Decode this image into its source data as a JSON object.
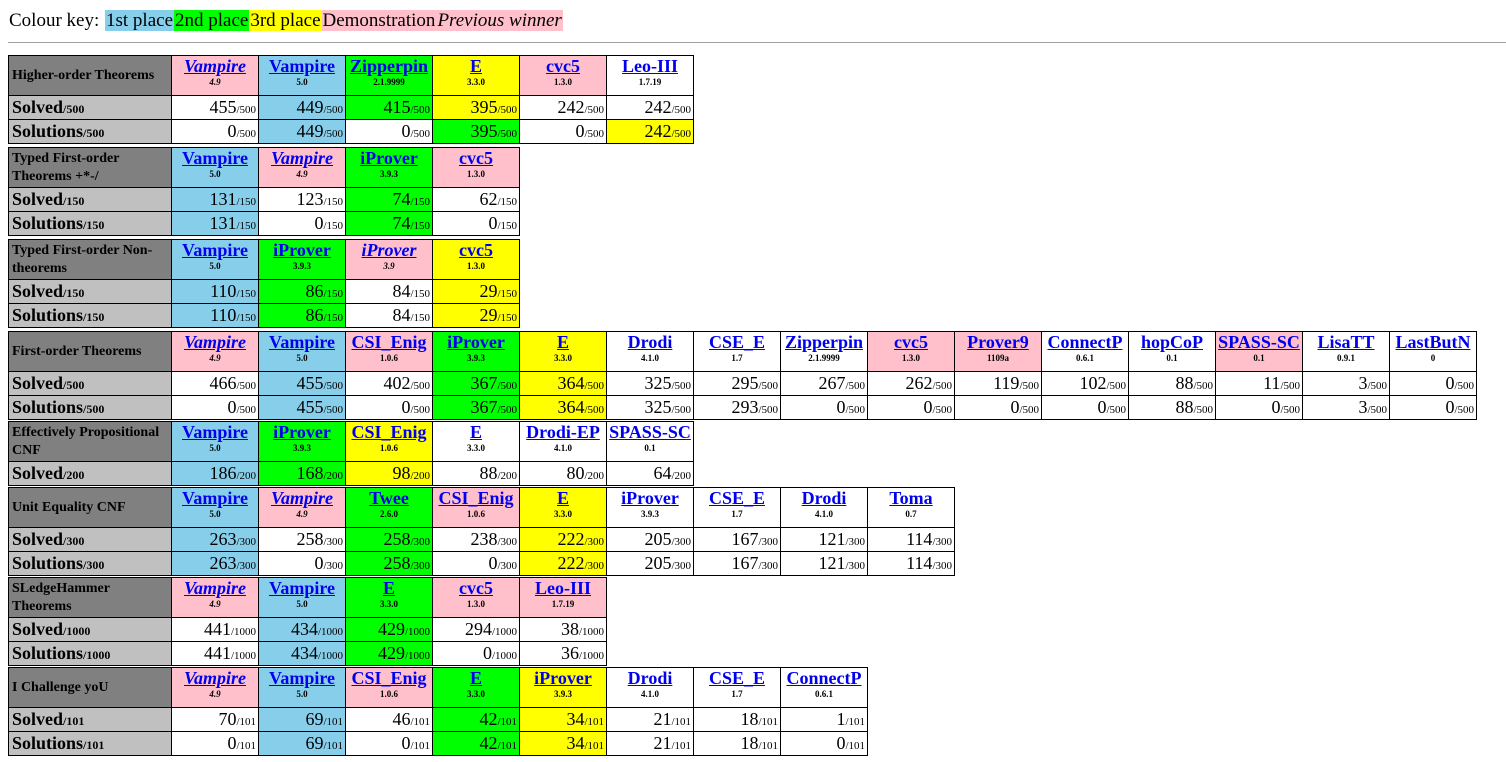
{
  "colour_key": {
    "label": "Colour key:",
    "items": [
      {
        "text": "1st place",
        "class": "first",
        "color": "#87ceeb"
      },
      {
        "text": "2nd place",
        "class": "second",
        "color": "#00ff00"
      },
      {
        "text": "3rd place",
        "class": "third",
        "color": "#ffff00"
      },
      {
        "text": "Demonstration",
        "class": "demo",
        "color": "#ffc0cb"
      },
      {
        "text": "Previous winner",
        "class": "prev",
        "color": "#ffc0cb"
      }
    ]
  },
  "divisions": [
    {
      "name": "Higher-order Theorems",
      "provers": [
        {
          "name": "Vampire",
          "version": "4.9",
          "status": "prev"
        },
        {
          "name": "Vampire",
          "version": "5.0",
          "status": "first"
        },
        {
          "name": "Zipperpin",
          "version": "2.1.9999",
          "status": "second"
        },
        {
          "name": "E",
          "version": "3.3.0",
          "status": "third"
        },
        {
          "name": "cvc5",
          "version": "1.3.0",
          "status": "demo"
        },
        {
          "name": "Leo-III",
          "version": "1.7.19",
          "status": "none"
        }
      ],
      "rows": [
        {
          "label": "Solved",
          "total": "/500",
          "values": [
            {
              "v": "455",
              "s": "none"
            },
            {
              "v": "449",
              "s": "first"
            },
            {
              "v": "415",
              "s": "second"
            },
            {
              "v": "395",
              "s": "third"
            },
            {
              "v": "242",
              "s": "none"
            },
            {
              "v": "242",
              "s": "none"
            }
          ]
        },
        {
          "label": "Solutions",
          "total": "/500",
          "values": [
            {
              "v": "0",
              "s": "none"
            },
            {
              "v": "449",
              "s": "first"
            },
            {
              "v": "0",
              "s": "none"
            },
            {
              "v": "395",
              "s": "second"
            },
            {
              "v": "0",
              "s": "none"
            },
            {
              "v": "242",
              "s": "third"
            }
          ]
        }
      ]
    },
    {
      "name": "Typed First-order Theorems +*-/",
      "provers": [
        {
          "name": "Vampire",
          "version": "5.0",
          "status": "first"
        },
        {
          "name": "Vampire",
          "version": "4.9",
          "status": "prev"
        },
        {
          "name": "iProver",
          "version": "3.9.3",
          "status": "second"
        },
        {
          "name": "cvc5",
          "version": "1.3.0",
          "status": "demo"
        }
      ],
      "rows": [
        {
          "label": "Solved",
          "total": "/150",
          "values": [
            {
              "v": "131",
              "s": "first"
            },
            {
              "v": "123",
              "s": "none"
            },
            {
              "v": "74",
              "s": "second"
            },
            {
              "v": "62",
              "s": "none"
            }
          ]
        },
        {
          "label": "Solutions",
          "total": "/150",
          "values": [
            {
              "v": "131",
              "s": "first"
            },
            {
              "v": "0",
              "s": "none"
            },
            {
              "v": "74",
              "s": "second"
            },
            {
              "v": "0",
              "s": "none"
            }
          ]
        }
      ]
    },
    {
      "name": "Typed First-order Non-theorems",
      "provers": [
        {
          "name": "Vampire",
          "version": "5.0",
          "status": "first"
        },
        {
          "name": "iProver",
          "version": "3.9.3",
          "status": "second"
        },
        {
          "name": "iProver",
          "version": "3.9",
          "status": "prev"
        },
        {
          "name": "cvc5",
          "version": "1.3.0",
          "status": "third"
        }
      ],
      "rows": [
        {
          "label": "Solved",
          "total": "/150",
          "values": [
            {
              "v": "110",
              "s": "first"
            },
            {
              "v": "86",
              "s": "second"
            },
            {
              "v": "84",
              "s": "none"
            },
            {
              "v": "29",
              "s": "third"
            }
          ]
        },
        {
          "label": "Solutions",
          "total": "/150",
          "values": [
            {
              "v": "110",
              "s": "first"
            },
            {
              "v": "86",
              "s": "second"
            },
            {
              "v": "84",
              "s": "none"
            },
            {
              "v": "29",
              "s": "third"
            }
          ]
        }
      ]
    },
    {
      "name": "First-order Theorems",
      "provers": [
        {
          "name": "Vampire",
          "version": "4.9",
          "status": "prev"
        },
        {
          "name": "Vampire",
          "version": "5.0",
          "status": "first"
        },
        {
          "name": "CSI_Enig",
          "version": "1.0.6",
          "status": "demo"
        },
        {
          "name": "iProver",
          "version": "3.9.3",
          "status": "second"
        },
        {
          "name": "E",
          "version": "3.3.0",
          "status": "third"
        },
        {
          "name": "Drodi",
          "version": "4.1.0",
          "status": "none"
        },
        {
          "name": "CSE_E",
          "version": "1.7",
          "status": "none"
        },
        {
          "name": "Zipperpin",
          "version": "2.1.9999",
          "status": "none"
        },
        {
          "name": "cvc5",
          "version": "1.3.0",
          "status": "demo"
        },
        {
          "name": "Prover9",
          "version": "1109a",
          "status": "demo"
        },
        {
          "name": "ConnectP",
          "version": "0.6.1",
          "status": "none"
        },
        {
          "name": "hopCoP",
          "version": "0.1",
          "status": "none"
        },
        {
          "name": "SPASS-SC",
          "version": "0.1",
          "status": "demo"
        },
        {
          "name": "LisaTT",
          "version": "0.9.1",
          "status": "none"
        },
        {
          "name": "LastButN",
          "version": "0",
          "status": "none"
        }
      ],
      "rows": [
        {
          "label": "Solved",
          "total": "/500",
          "values": [
            {
              "v": "466",
              "s": "none"
            },
            {
              "v": "455",
              "s": "first"
            },
            {
              "v": "402",
              "s": "none"
            },
            {
              "v": "367",
              "s": "second"
            },
            {
              "v": "364",
              "s": "third"
            },
            {
              "v": "325",
              "s": "none"
            },
            {
              "v": "295",
              "s": "none"
            },
            {
              "v": "267",
              "s": "none"
            },
            {
              "v": "262",
              "s": "none"
            },
            {
              "v": "119",
              "s": "none"
            },
            {
              "v": "102",
              "s": "none"
            },
            {
              "v": "88",
              "s": "none"
            },
            {
              "v": "11",
              "s": "none"
            },
            {
              "v": "3",
              "s": "none"
            },
            {
              "v": "0",
              "s": "none"
            }
          ]
        },
        {
          "label": "Solutions",
          "total": "/500",
          "values": [
            {
              "v": "0",
              "s": "none"
            },
            {
              "v": "455",
              "s": "first"
            },
            {
              "v": "0",
              "s": "none"
            },
            {
              "v": "367",
              "s": "second"
            },
            {
              "v": "364",
              "s": "third"
            },
            {
              "v": "325",
              "s": "none"
            },
            {
              "v": "293",
              "s": "none"
            },
            {
              "v": "0",
              "s": "none"
            },
            {
              "v": "0",
              "s": "none"
            },
            {
              "v": "0",
              "s": "none"
            },
            {
              "v": "0",
              "s": "none"
            },
            {
              "v": "88",
              "s": "none"
            },
            {
              "v": "0",
              "s": "none"
            },
            {
              "v": "3",
              "s": "none"
            },
            {
              "v": "0",
              "s": "none"
            }
          ]
        }
      ]
    },
    {
      "name": "Effectively Propositional CNF",
      "provers": [
        {
          "name": "Vampire",
          "version": "5.0",
          "status": "first"
        },
        {
          "name": "iProver",
          "version": "3.9.3",
          "status": "second"
        },
        {
          "name": "CSI_Enig",
          "version": "1.0.6",
          "status": "third"
        },
        {
          "name": "E",
          "version": "3.3.0",
          "status": "none"
        },
        {
          "name": "Drodi-EP",
          "version": "4.1.0",
          "status": "none"
        },
        {
          "name": "SPASS-SC",
          "version": "0.1",
          "status": "none"
        }
      ],
      "rows": [
        {
          "label": "Solved",
          "total": "/200",
          "values": [
            {
              "v": "186",
              "s": "first"
            },
            {
              "v": "168",
              "s": "second"
            },
            {
              "v": "98",
              "s": "third"
            },
            {
              "v": "88",
              "s": "none"
            },
            {
              "v": "80",
              "s": "none"
            },
            {
              "v": "64",
              "s": "none"
            }
          ]
        }
      ]
    },
    {
      "name": "Unit Equality CNF",
      "provers": [
        {
          "name": "Vampire",
          "version": "5.0",
          "status": "first"
        },
        {
          "name": "Vampire",
          "version": "4.9",
          "status": "prev"
        },
        {
          "name": "Twee",
          "version": "2.6.0",
          "status": "second"
        },
        {
          "name": "CSI_Enig",
          "version": "1.0.6",
          "status": "demo"
        },
        {
          "name": "E",
          "version": "3.3.0",
          "status": "third"
        },
        {
          "name": "iProver",
          "version": "3.9.3",
          "status": "none"
        },
        {
          "name": "CSE_E",
          "version": "1.7",
          "status": "none"
        },
        {
          "name": "Drodi",
          "version": "4.1.0",
          "status": "none"
        },
        {
          "name": "Toma",
          "version": "0.7",
          "status": "none"
        }
      ],
      "rows": [
        {
          "label": "Solved",
          "total": "/300",
          "values": [
            {
              "v": "263",
              "s": "first"
            },
            {
              "v": "258",
              "s": "none"
            },
            {
              "v": "258",
              "s": "second"
            },
            {
              "v": "238",
              "s": "none"
            },
            {
              "v": "222",
              "s": "third"
            },
            {
              "v": "205",
              "s": "none"
            },
            {
              "v": "167",
              "s": "none"
            },
            {
              "v": "121",
              "s": "none"
            },
            {
              "v": "114",
              "s": "none"
            }
          ]
        },
        {
          "label": "Solutions",
          "total": "/300",
          "values": [
            {
              "v": "263",
              "s": "first"
            },
            {
              "v": "0",
              "s": "none"
            },
            {
              "v": "258",
              "s": "second"
            },
            {
              "v": "0",
              "s": "none"
            },
            {
              "v": "222",
              "s": "third"
            },
            {
              "v": "205",
              "s": "none"
            },
            {
              "v": "167",
              "s": "none"
            },
            {
              "v": "121",
              "s": "none"
            },
            {
              "v": "114",
              "s": "none"
            }
          ]
        }
      ]
    },
    {
      "name": "SLedgeHammer Theorems",
      "provers": [
        {
          "name": "Vampire",
          "version": "4.9",
          "status": "prev"
        },
        {
          "name": "Vampire",
          "version": "5.0",
          "status": "first"
        },
        {
          "name": "E",
          "version": "3.3.0",
          "status": "second"
        },
        {
          "name": "cvc5",
          "version": "1.3.0",
          "status": "demo"
        },
        {
          "name": "Leo-III",
          "version": "1.7.19",
          "status": "demo"
        }
      ],
      "rows": [
        {
          "label": "Solved",
          "total": "/1000",
          "values": [
            {
              "v": "441",
              "s": "none"
            },
            {
              "v": "434",
              "s": "first"
            },
            {
              "v": "429",
              "s": "second"
            },
            {
              "v": "294",
              "s": "none"
            },
            {
              "v": "38",
              "s": "none"
            }
          ]
        },
        {
          "label": "Solutions",
          "total": "/1000",
          "values": [
            {
              "v": "441",
              "s": "none"
            },
            {
              "v": "434",
              "s": "first"
            },
            {
              "v": "429",
              "s": "second"
            },
            {
              "v": "0",
              "s": "none"
            },
            {
              "v": "36",
              "s": "none"
            }
          ]
        }
      ]
    },
    {
      "name": "I Challenge yoU",
      "provers": [
        {
          "name": "Vampire",
          "version": "4.9",
          "status": "prev"
        },
        {
          "name": "Vampire",
          "version": "5.0",
          "status": "first"
        },
        {
          "name": "CSI_Enig",
          "version": "1.0.6",
          "status": "demo"
        },
        {
          "name": "E",
          "version": "3.3.0",
          "status": "second"
        },
        {
          "name": "iProver",
          "version": "3.9.3",
          "status": "third"
        },
        {
          "name": "Drodi",
          "version": "4.1.0",
          "status": "none"
        },
        {
          "name": "CSE_E",
          "version": "1.7",
          "status": "none"
        },
        {
          "name": "ConnectP",
          "version": "0.6.1",
          "status": "none"
        }
      ],
      "rows": [
        {
          "label": "Solved",
          "total": "/101",
          "values": [
            {
              "v": "70",
              "s": "none"
            },
            {
              "v": "69",
              "s": "first"
            },
            {
              "v": "46",
              "s": "none"
            },
            {
              "v": "42",
              "s": "second"
            },
            {
              "v": "34",
              "s": "third"
            },
            {
              "v": "21",
              "s": "none"
            },
            {
              "v": "18",
              "s": "none"
            },
            {
              "v": "1",
              "s": "none"
            }
          ]
        },
        {
          "label": "Solutions",
          "total": "/101",
          "values": [
            {
              "v": "0",
              "s": "none"
            },
            {
              "v": "69",
              "s": "first"
            },
            {
              "v": "0",
              "s": "none"
            },
            {
              "v": "42",
              "s": "second"
            },
            {
              "v": "34",
              "s": "third"
            },
            {
              "v": "21",
              "s": "none"
            },
            {
              "v": "18",
              "s": "none"
            },
            {
              "v": "0",
              "s": "none"
            }
          ]
        }
      ]
    }
  ]
}
